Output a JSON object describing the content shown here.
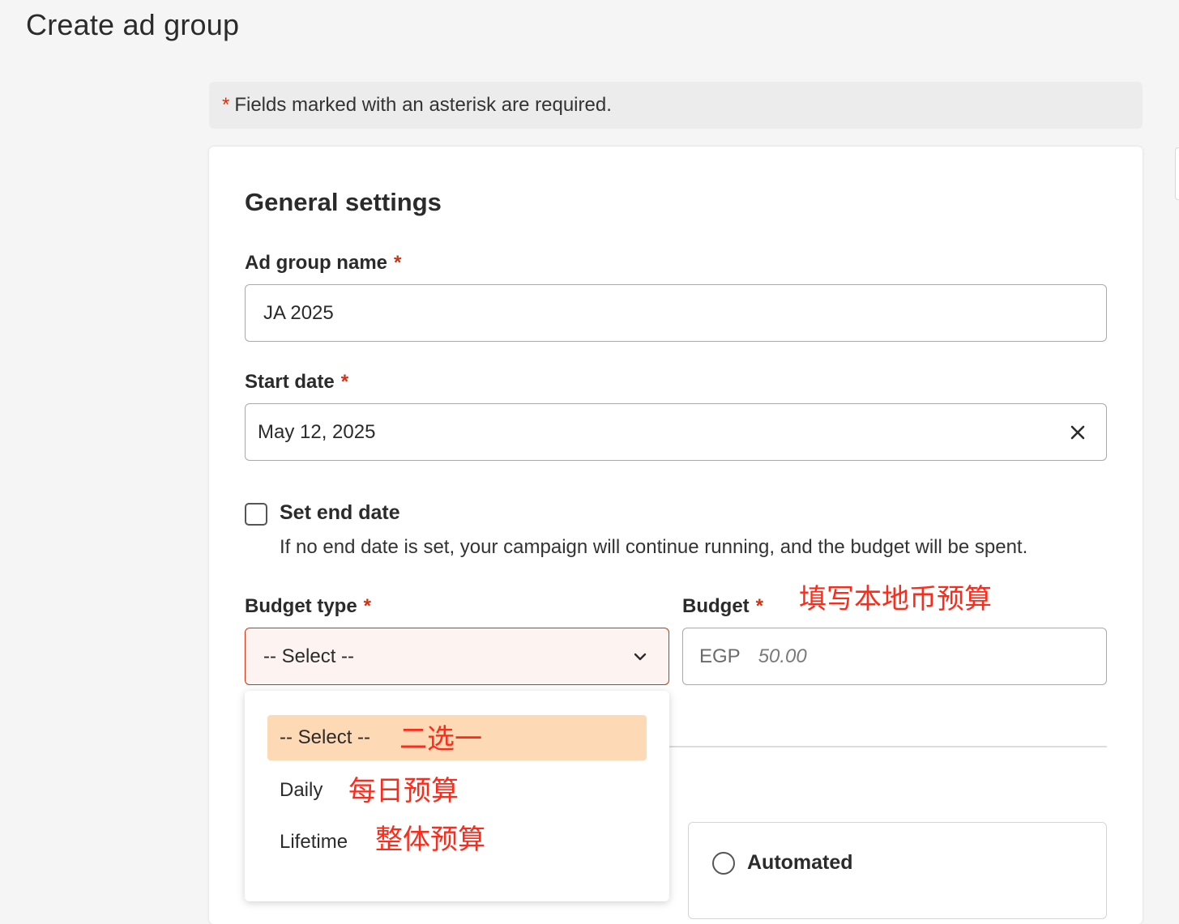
{
  "page": {
    "title": "Create ad group"
  },
  "notice": {
    "asterisk": "*",
    "text": "Fields marked with an asterisk are required."
  },
  "general_settings": {
    "title": "General settings",
    "ad_group_name": {
      "label": "Ad group name",
      "required": "*",
      "value": "JA 2025"
    },
    "start_date": {
      "label": "Start date",
      "required": "*",
      "value": "May 12, 2025"
    },
    "end_date": {
      "label": "Set end date",
      "checked": false,
      "help": "If no end date is set, your campaign will continue running, and the budget will be spent."
    },
    "budget_type": {
      "label": "Budget type",
      "required": "*",
      "selected": "-- Select --",
      "options": [
        {
          "label": "-- Select --",
          "annotation": "二选一",
          "selected": true
        },
        {
          "label": "Daily",
          "annotation": "每日预算"
        },
        {
          "label": "Lifetime",
          "annotation": "整体预算"
        }
      ]
    },
    "budget": {
      "label": "Budget",
      "required": "*",
      "currency": "EGP",
      "placeholder": "50.00",
      "annotation": "填写本地币预算"
    }
  },
  "bidding": {
    "automated_label": "Automated"
  },
  "colors": {
    "required": "#d13212",
    "annotation": "#ff2a1a",
    "selected_option": "#fdd9b5"
  },
  "icons": {
    "clear": "close-icon",
    "dropdown": "chevron-down-icon"
  }
}
